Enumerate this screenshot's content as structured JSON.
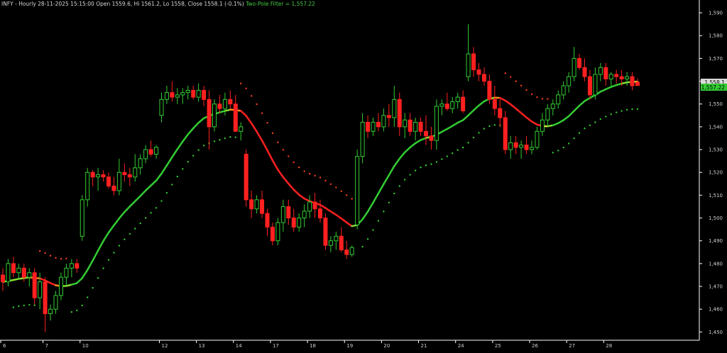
{
  "header": {
    "title": "INFY - Hourly 28-11-2025 15:15:00 Open 1559.6, Hi 1561.2, Lo 1558, Close 1558.1 (-0.1%)",
    "filter_label": "Two-Pole Filter = 1,557.22"
  },
  "colors": {
    "background": "#000000",
    "bull": "#33cc33",
    "bear": "#ff2020",
    "axis_text": "#cfcfcf",
    "price_tag_bg": "#d9d9d9",
    "filter_tag_bg": "#33cc33"
  },
  "chart_data": {
    "type": "candlestick",
    "ylim": [
      1447,
      1595
    ],
    "yticks": [
      "1,450",
      "1,460",
      "1,470",
      "1,480",
      "1,490",
      "1,500",
      "1,510",
      "1,520",
      "1,530",
      "1,540",
      "1,550",
      "1,560",
      "1,570",
      "1,580",
      "1,590"
    ],
    "xticks": [
      {
        "label": "6",
        "idx": 0
      },
      {
        "label": "7",
        "idx": 8
      },
      {
        "label": "10",
        "idx": 15
      },
      {
        "label": "12",
        "idx": 30
      },
      {
        "label": "13",
        "idx": 37
      },
      {
        "label": "14",
        "idx": 44
      },
      {
        "label": "17",
        "idx": 51
      },
      {
        "label": "18",
        "idx": 58
      },
      {
        "label": "19",
        "idx": 65
      },
      {
        "label": "20",
        "idx": 72
      },
      {
        "label": "21",
        "idx": 79
      },
      {
        "label": "24",
        "idx": 86
      },
      {
        "label": "25",
        "idx": 93
      },
      {
        "label": "26",
        "idx": 100
      },
      {
        "label": "27",
        "idx": 107
      },
      {
        "label": "28",
        "idx": 114
      }
    ],
    "last_close_label": "1,558.1",
    "filter_last_label": "1,557.22",
    "candles": [
      [
        1475,
        1478,
        1468,
        1472
      ],
      [
        1472,
        1482,
        1470,
        1480
      ],
      [
        1480,
        1483,
        1474,
        1476
      ],
      [
        1476,
        1480,
        1473,
        1478
      ],
      [
        1478,
        1480,
        1472,
        1474
      ],
      [
        1474,
        1478,
        1470,
        1476
      ],
      [
        1476,
        1478,
        1462,
        1465
      ],
      [
        1465,
        1476,
        1460,
        1472
      ],
      [
        1472,
        1474,
        1450,
        1458
      ],
      [
        1458,
        1462,
        1455,
        1460
      ],
      [
        1460,
        1468,
        1458,
        1466
      ],
      [
        1466,
        1476,
        1464,
        1474
      ],
      [
        1474,
        1480,
        1470,
        1478
      ],
      [
        1478,
        1482,
        1474,
        1480
      ],
      [
        1480,
        1482,
        1476,
        1478
      ],
      [
        1492,
        1510,
        1490,
        1508
      ],
      [
        1508,
        1522,
        1505,
        1520
      ],
      [
        1520,
        1521,
        1514,
        1518
      ],
      [
        1518,
        1522,
        1512,
        1519
      ],
      [
        1519,
        1521,
        1516,
        1518
      ],
      [
        1518,
        1520,
        1513,
        1514
      ],
      [
        1514,
        1518,
        1510,
        1512
      ],
      [
        1512,
        1526,
        1510,
        1520
      ],
      [
        1520,
        1524,
        1516,
        1519
      ],
      [
        1519,
        1522,
        1514,
        1518
      ],
      [
        1518,
        1528,
        1516,
        1522
      ],
      [
        1522,
        1528,
        1519,
        1526
      ],
      [
        1526,
        1532,
        1524,
        1530
      ],
      [
        1530,
        1534,
        1527,
        1528
      ],
      [
        1528,
        1532,
        1526,
        1531
      ],
      [
        1545,
        1555,
        1542,
        1552
      ],
      [
        1552,
        1558,
        1550,
        1555
      ],
      [
        1555,
        1560,
        1551,
        1553
      ],
      [
        1553,
        1557,
        1550,
        1554
      ],
      [
        1554,
        1557,
        1550,
        1555
      ],
      [
        1555,
        1558,
        1552,
        1556
      ],
      [
        1556,
        1558,
        1552,
        1553
      ],
      [
        1553,
        1559,
        1551,
        1556
      ],
      [
        1556,
        1558,
        1549,
        1552
      ],
      [
        1552,
        1556,
        1530,
        1540
      ],
      [
        1540,
        1552,
        1538,
        1550
      ],
      [
        1550,
        1554,
        1546,
        1548
      ],
      [
        1548,
        1555,
        1545,
        1552
      ],
      [
        1552,
        1556,
        1548,
        1550
      ],
      [
        1550,
        1554,
        1540,
        1538
      ],
      [
        1538,
        1542,
        1534,
        1540
      ],
      [
        1528,
        1530,
        1505,
        1508
      ],
      [
        1508,
        1512,
        1500,
        1504
      ],
      [
        1504,
        1510,
        1502,
        1508
      ],
      [
        1508,
        1512,
        1500,
        1502
      ],
      [
        1502,
        1504,
        1492,
        1496
      ],
      [
        1496,
        1498,
        1488,
        1490
      ],
      [
        1490,
        1500,
        1488,
        1498
      ],
      [
        1498,
        1508,
        1494,
        1505
      ],
      [
        1505,
        1508,
        1497,
        1500
      ],
      [
        1500,
        1504,
        1494,
        1496
      ],
      [
        1496,
        1502,
        1494,
        1500
      ],
      [
        1500,
        1506,
        1496,
        1503
      ],
      [
        1503,
        1510,
        1500,
        1507
      ],
      [
        1507,
        1511,
        1500,
        1504
      ],
      [
        1504,
        1508,
        1498,
        1500
      ],
      [
        1500,
        1502,
        1486,
        1488
      ],
      [
        1488,
        1492,
        1485,
        1490
      ],
      [
        1490,
        1494,
        1486,
        1492
      ],
      [
        1492,
        1496,
        1485,
        1486
      ],
      [
        1486,
        1490,
        1482,
        1484
      ],
      [
        1484,
        1488,
        1483,
        1487
      ],
      [
        1497,
        1530,
        1495,
        1527
      ],
      [
        1527,
        1546,
        1524,
        1542
      ],
      [
        1542,
        1545,
        1535,
        1538
      ],
      [
        1538,
        1544,
        1536,
        1542
      ],
      [
        1542,
        1546,
        1538,
        1540
      ],
      [
        1540,
        1548,
        1538,
        1545
      ],
      [
        1545,
        1550,
        1540,
        1544
      ],
      [
        1544,
        1558,
        1540,
        1552
      ],
      [
        1552,
        1555,
        1536,
        1540
      ],
      [
        1540,
        1546,
        1535,
        1543
      ],
      [
        1543,
        1546,
        1536,
        1538
      ],
      [
        1538,
        1544,
        1534,
        1542
      ],
      [
        1542,
        1544,
        1536,
        1538
      ],
      [
        1538,
        1545,
        1532,
        1536
      ],
      [
        1536,
        1540,
        1530,
        1534
      ],
      [
        1534,
        1552,
        1530,
        1549
      ],
      [
        1549,
        1552,
        1545,
        1550
      ],
      [
        1550,
        1555,
        1547,
        1548
      ],
      [
        1548,
        1553,
        1546,
        1551
      ],
      [
        1551,
        1555,
        1548,
        1553
      ],
      [
        1553,
        1556,
        1546,
        1547
      ],
      [
        1562,
        1585,
        1560,
        1572
      ],
      [
        1572,
        1575,
        1562,
        1565
      ],
      [
        1565,
        1568,
        1560,
        1563
      ],
      [
        1563,
        1566,
        1558,
        1560
      ],
      [
        1560,
        1563,
        1550,
        1552
      ],
      [
        1552,
        1558,
        1545,
        1548
      ],
      [
        1548,
        1552,
        1540,
        1544
      ],
      [
        1544,
        1547,
        1528,
        1530
      ],
      [
        1530,
        1536,
        1526,
        1533
      ],
      [
        1533,
        1536,
        1528,
        1531
      ],
      [
        1531,
        1534,
        1526,
        1532
      ],
      [
        1532,
        1536,
        1528,
        1530
      ],
      [
        1530,
        1534,
        1528,
        1531
      ],
      [
        1531,
        1540,
        1530,
        1538
      ],
      [
        1538,
        1546,
        1536,
        1543
      ],
      [
        1543,
        1550,
        1540,
        1548
      ],
      [
        1548,
        1552,
        1545,
        1550
      ],
      [
        1550,
        1556,
        1548,
        1554
      ],
      [
        1554,
        1560,
        1552,
        1558
      ],
      [
        1558,
        1564,
        1555,
        1562
      ],
      [
        1562,
        1575,
        1560,
        1570
      ],
      [
        1570,
        1572,
        1565,
        1566
      ],
      [
        1566,
        1570,
        1560,
        1562
      ],
      [
        1562,
        1565,
        1552,
        1554
      ],
      [
        1554,
        1566,
        1552,
        1563
      ],
      [
        1563,
        1568,
        1560,
        1566
      ],
      [
        1566,
        1568,
        1558,
        1561
      ],
      [
        1561,
        1564,
        1558,
        1563
      ],
      [
        1563,
        1565,
        1559,
        1562
      ],
      [
        1562,
        1565,
        1558,
        1561
      ],
      [
        1561,
        1564,
        1558,
        1562
      ],
      [
        1562,
        1564,
        1556,
        1558
      ],
      [
        1559.6,
        1561.2,
        1558,
        1558.1
      ]
    ]
  }
}
